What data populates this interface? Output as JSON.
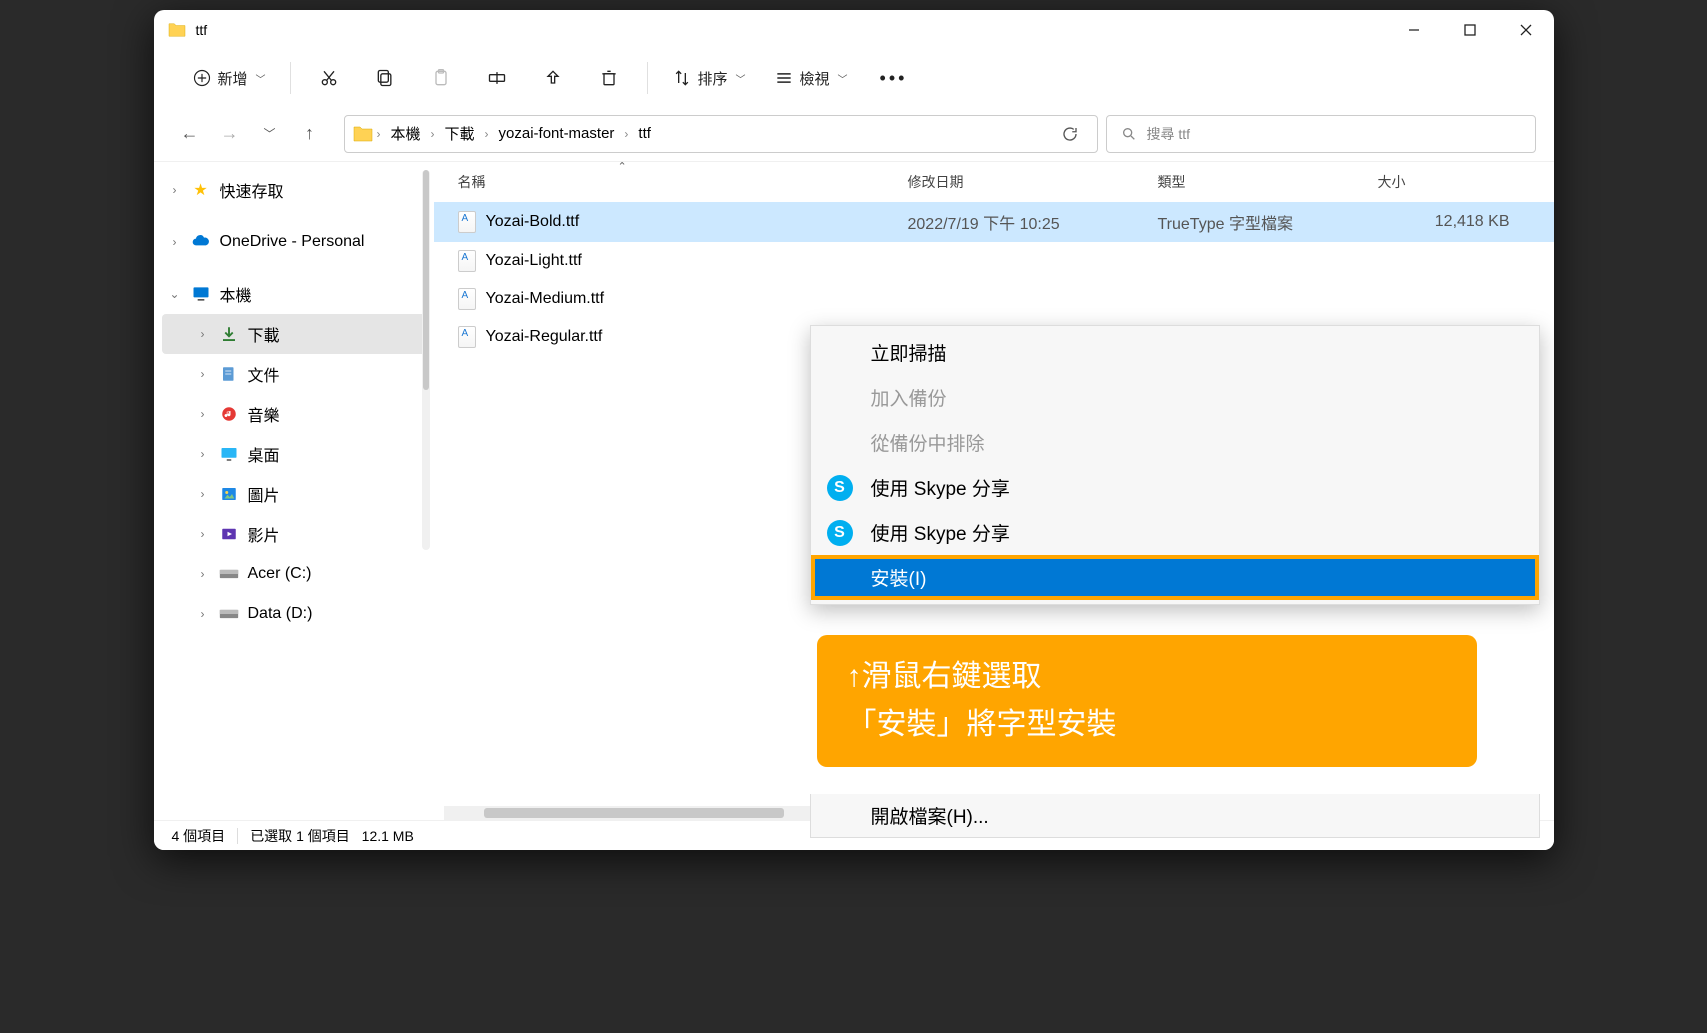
{
  "window": {
    "title": "ttf"
  },
  "toolbar": {
    "new": "新增",
    "sort": "排序",
    "view": "檢視"
  },
  "breadcrumb": [
    "本機",
    "下載",
    "yozai-font-master",
    "ttf"
  ],
  "search": {
    "placeholder": "搜尋 ttf"
  },
  "sidebar": {
    "quick_access": "快速存取",
    "onedrive": "OneDrive - Personal",
    "thispc": "本機",
    "downloads": "下載",
    "documents": "文件",
    "music": "音樂",
    "desktop": "桌面",
    "pictures": "圖片",
    "videos": "影片",
    "drive_c": "Acer (C:)",
    "drive_d": "Data (D:)"
  },
  "columns": {
    "name": "名稱",
    "modified": "修改日期",
    "type": "類型",
    "size": "大小"
  },
  "files": [
    {
      "name": "Yozai-Bold.ttf",
      "date": "2022/7/19 下午 10:25",
      "type": "TrueType 字型檔案",
      "size": "12,418 KB"
    },
    {
      "name": "Yozai-Light.ttf",
      "date": "",
      "type": "",
      "size": ""
    },
    {
      "name": "Yozai-Medium.ttf",
      "date": "",
      "type": "",
      "size": ""
    },
    {
      "name": "Yozai-Regular.ttf",
      "date": "",
      "type": "",
      "size": ""
    }
  ],
  "context_menu": {
    "scan": "立即掃描",
    "add_backup": "加入備份",
    "exclude_backup": "從備份中排除",
    "skype1": "使用 Skype 分享",
    "skype2": "使用 Skype 分享",
    "install": "安裝(I)",
    "open_with": "開啟檔案(H)..."
  },
  "callout": {
    "line1": "↑滑鼠右鍵選取",
    "line2": "「安裝」將字型安裝"
  },
  "statusbar": {
    "items": "4 個項目",
    "selected": "已選取 1 個項目",
    "size": "12.1 MB"
  }
}
